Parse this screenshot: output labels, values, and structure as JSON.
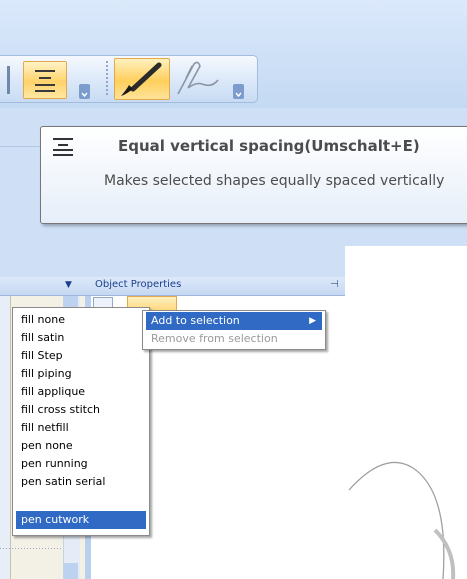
{
  "tooltip": {
    "title": "Equal vertical spacing(Umschalt+E)",
    "description": "Makes selected shapes equally spaced vertically"
  },
  "panel": {
    "title": "Object Properties"
  },
  "context_menu": {
    "items": [
      "fill none",
      "fill satin",
      "fill Step",
      "fill piping",
      "fill applique",
      "fill cross stitch",
      "fill netfill",
      "pen none",
      "pen running",
      "pen satin serial",
      "pen cutwork"
    ],
    "selected": "pen cutwork"
  },
  "submenu": {
    "add_label": "Add to selection",
    "remove_label": "Remove from selection"
  },
  "icons": {
    "spacing": "equal-vertical-spacing-icon",
    "brush": "paintbrush-icon",
    "pen": "pen-icon",
    "pin": "pin-icon"
  },
  "colors": {
    "selection": "#316ac5",
    "highlight": "#ffd36b"
  }
}
